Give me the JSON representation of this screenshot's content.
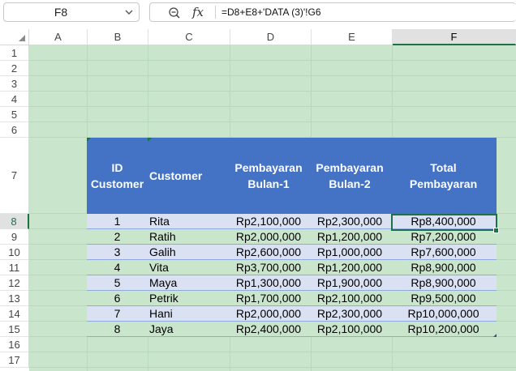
{
  "name_box": {
    "value": "F8"
  },
  "formula_bar": {
    "formula": "=D8+E8+'DATA (3)'!G6"
  },
  "columns": [
    "A",
    "B",
    "C",
    "D",
    "E",
    "F"
  ],
  "rows": [
    "1",
    "2",
    "3",
    "4",
    "5",
    "6",
    "7",
    "8",
    "9",
    "10",
    "11",
    "12",
    "13",
    "14",
    "15",
    "16",
    "17"
  ],
  "selected": {
    "column": "F",
    "row": "8"
  },
  "table": {
    "headers": {
      "id": [
        "ID",
        "Customer"
      ],
      "customer": "Customer",
      "bulan1": [
        "Pembayaran",
        "Bulan-1"
      ],
      "bulan2": [
        "Pembayaran",
        "Bulan-2"
      ],
      "total": [
        "Total",
        "Pembayaran"
      ]
    },
    "rows": [
      {
        "id": "1",
        "customer": "Rita",
        "bulan1": "Rp2,100,000",
        "bulan2": "Rp2,300,000",
        "total": "Rp8,400,000"
      },
      {
        "id": "2",
        "customer": "Ratih",
        "bulan1": "Rp2,000,000",
        "bulan2": "Rp1,200,000",
        "total": "Rp7,200,000"
      },
      {
        "id": "3",
        "customer": "Galih",
        "bulan1": "Rp2,600,000",
        "bulan2": "Rp1,000,000",
        "total": "Rp7,600,000"
      },
      {
        "id": "4",
        "customer": "Vita",
        "bulan1": "Rp3,700,000",
        "bulan2": "Rp1,200,000",
        "total": "Rp8,900,000"
      },
      {
        "id": "5",
        "customer": "Maya",
        "bulan1": "Rp1,300,000",
        "bulan2": "Rp1,900,000",
        "total": "Rp8,900,000"
      },
      {
        "id": "6",
        "customer": "Petrik",
        "bulan1": "Rp1,700,000",
        "bulan2": "Rp2,100,000",
        "total": "Rp9,500,000"
      },
      {
        "id": "7",
        "customer": "Hani",
        "bulan1": "Rp2,000,000",
        "bulan2": "Rp2,300,000",
        "total": "Rp10,000,000"
      },
      {
        "id": "8",
        "customer": "Jaya",
        "bulan1": "Rp2,400,000",
        "bulan2": "Rp2,100,000",
        "total": "Rp10,200,000"
      }
    ]
  },
  "colors": {
    "sheet_bg": "#c9e6cc",
    "header_fill": "#4472c4",
    "band_fill": "#d9e1f2",
    "selection": "#1e7145"
  }
}
